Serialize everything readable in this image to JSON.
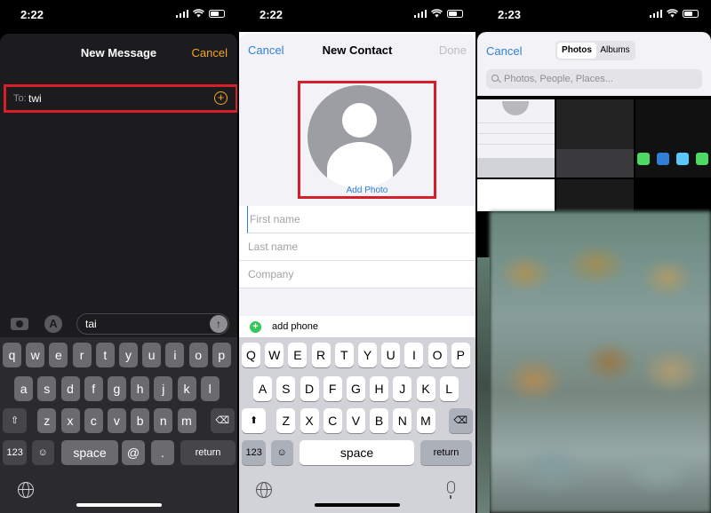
{
  "panel1": {
    "time": "2:22",
    "title": "New Message",
    "cancel": "Cancel",
    "to_label": "To:",
    "to_value": "twi",
    "message_text": "tai",
    "keyboard": {
      "row1": [
        "q",
        "w",
        "e",
        "r",
        "t",
        "y",
        "u",
        "i",
        "o",
        "p"
      ],
      "row2": [
        "a",
        "s",
        "d",
        "f",
        "g",
        "h",
        "j",
        "k",
        "l"
      ],
      "row3": [
        "z",
        "x",
        "c",
        "v",
        "b",
        "n",
        "m"
      ],
      "num": "123",
      "space": "space",
      "at": "@",
      "dot": ".",
      "return": "return"
    }
  },
  "panel2": {
    "time": "2:22",
    "title": "New Contact",
    "cancel": "Cancel",
    "done": "Done",
    "add_photo": "Add Photo",
    "fields": [
      {
        "placeholder": "First name"
      },
      {
        "placeholder": "Last name"
      },
      {
        "placeholder": "Company"
      }
    ],
    "add_phone": "add phone",
    "keyboard": {
      "row1": [
        "Q",
        "W",
        "E",
        "R",
        "T",
        "Y",
        "U",
        "I",
        "O",
        "P"
      ],
      "row2": [
        "A",
        "S",
        "D",
        "F",
        "G",
        "H",
        "J",
        "K",
        "L"
      ],
      "row3": [
        "Z",
        "X",
        "C",
        "V",
        "B",
        "N",
        "M"
      ],
      "num": "123",
      "space": "space",
      "return": "return"
    }
  },
  "panel3": {
    "time": "2:23",
    "cancel": "Cancel",
    "segments": [
      "Photos",
      "Albums"
    ],
    "selected_segment": "Photos",
    "search_placeholder": "Photos, People, Places..."
  },
  "colors": {
    "orange_accent": "#f5a623",
    "ios_blue": "#2f7fd9",
    "highlight_red": "#d61f2a",
    "add_green": "#34c759"
  }
}
